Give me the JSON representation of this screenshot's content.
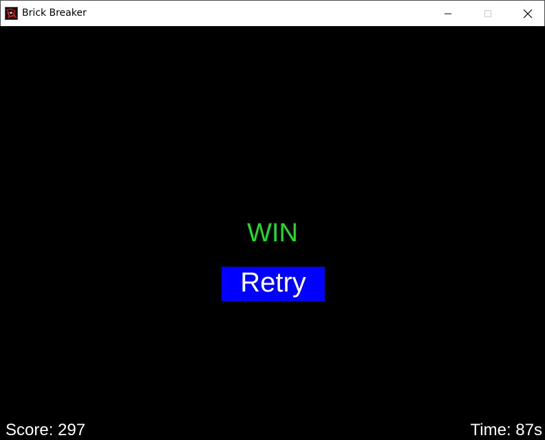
{
  "window": {
    "title": "Brick Breaker",
    "icon": "brick-breaker-app-icon",
    "controls": [
      "minimize-icon",
      "maximize-icon",
      "close-icon"
    ]
  },
  "game": {
    "status_text": "WIN",
    "status_color": "#22dd22",
    "retry_label": "Retry",
    "retry_bg": "#0000ff",
    "score_text": "Score: 297",
    "time_text": "Time: 87s",
    "background": "#000000"
  }
}
